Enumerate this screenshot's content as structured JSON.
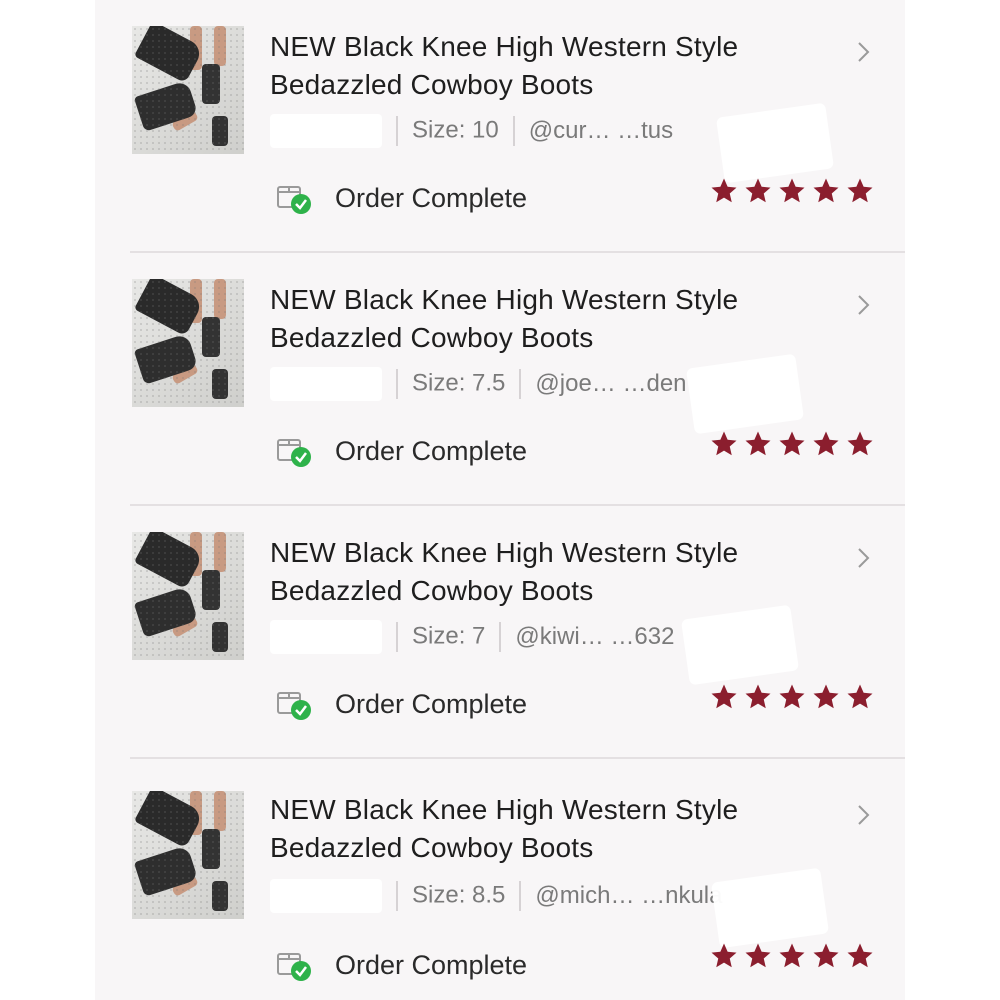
{
  "colors": {
    "star": "#8b1e2e",
    "check": "#2eb24a",
    "title_text": "#1e1e1e",
    "meta_text": "#7a7a7a",
    "panel_bg": "#f8f6f7"
  },
  "orders": [
    {
      "title": "NEW Black Knee High Western Style Bedazzled Cowboy Boots",
      "size_label": "Size:",
      "size_value": "10",
      "handle": "@cur… …tus",
      "status": "Order Complete",
      "rating": 5,
      "thumbnail_icon": "boots-photo",
      "chevron_icon": "chevron-right-icon"
    },
    {
      "title": "NEW Black Knee High Western Style Bedazzled Cowboy Boots",
      "size_label": "Size:",
      "size_value": "7.5",
      "handle": "@joe… …den",
      "status": "Order Complete",
      "rating": 5,
      "thumbnail_icon": "boots-photo",
      "chevron_icon": "chevron-right-icon"
    },
    {
      "title": "NEW Black Knee High Western Style Bedazzled Cowboy Boots",
      "size_label": "Size:",
      "size_value": "7",
      "handle": "@kiwi… …632",
      "status": "Order Complete",
      "rating": 5,
      "thumbnail_icon": "boots-photo",
      "chevron_icon": "chevron-right-icon"
    },
    {
      "title": "NEW Black Knee High Western Style Bedazzled Cowboy Boots",
      "size_label": "Size:",
      "size_value": "8.5",
      "handle": "@mich… …nkula",
      "status": "Order Complete",
      "rating": 5,
      "thumbnail_icon": "boots-photo",
      "chevron_icon": "chevron-right-icon"
    }
  ]
}
